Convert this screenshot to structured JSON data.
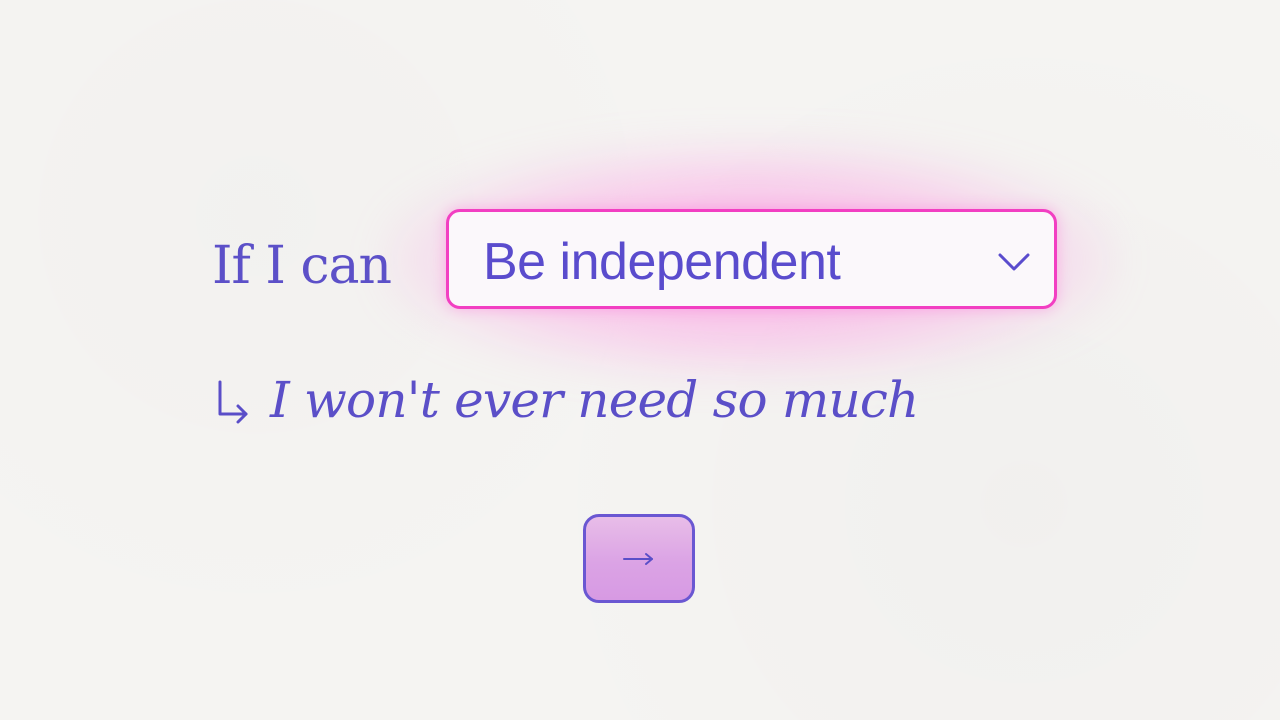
{
  "form": {
    "prefix_label": "If I can",
    "select_value": "Be independent",
    "subline_text": "I won't ever need so much"
  },
  "icons": {
    "dropdown": "chevron-down-icon",
    "return_arrow": "return-arrow-icon",
    "next": "arrow-right-icon"
  },
  "colors": {
    "accent_pink": "#f23fc2",
    "text_purple": "#5b4fc8",
    "button_fill": "#d79ae3"
  }
}
